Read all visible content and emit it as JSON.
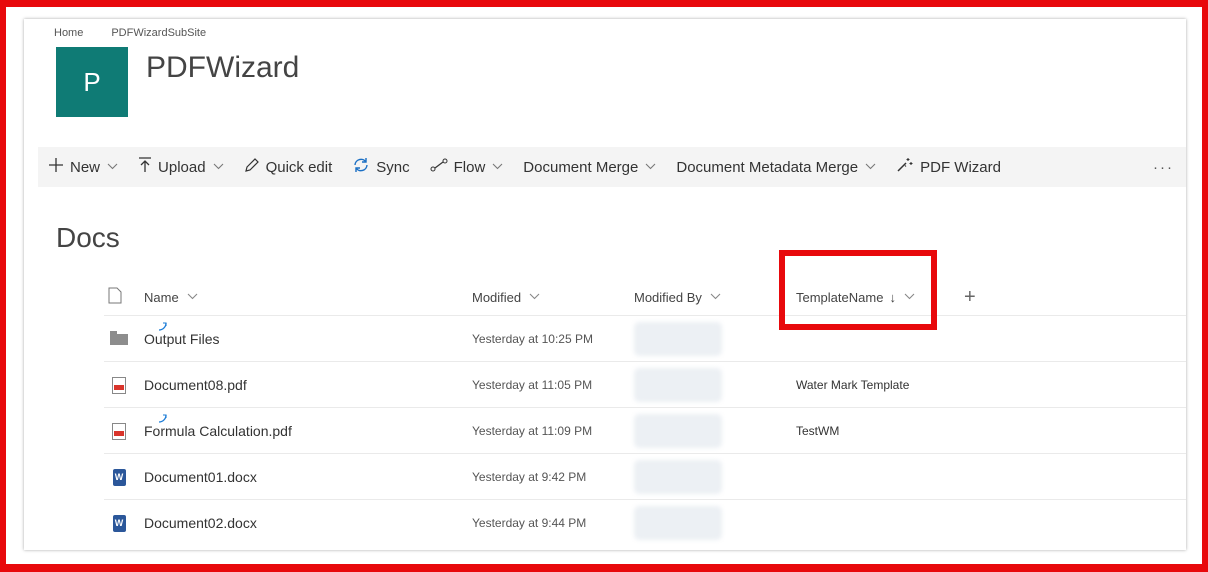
{
  "breadcrumb": [
    "Home",
    "PDFWizardSubSite"
  ],
  "site": {
    "logo_letter": "P",
    "title": "PDFWizard"
  },
  "commands": [
    {
      "id": "new",
      "icon": "plus-icon",
      "label": "New",
      "dropdown": true
    },
    {
      "id": "upload",
      "icon": "upload-icon",
      "label": "Upload",
      "dropdown": true
    },
    {
      "id": "quick-edit",
      "icon": "pencil-icon",
      "label": "Quick edit",
      "dropdown": false
    },
    {
      "id": "sync",
      "icon": "sync-icon",
      "label": "Sync",
      "dropdown": false
    },
    {
      "id": "flow",
      "icon": "flow-icon",
      "label": "Flow",
      "dropdown": true
    },
    {
      "id": "document-merge",
      "icon": "",
      "label": "Document Merge",
      "dropdown": true
    },
    {
      "id": "document-metadata-merge",
      "icon": "",
      "label": "Document Metadata Merge",
      "dropdown": true
    },
    {
      "id": "pdf-wizard",
      "icon": "wand-icon",
      "label": "PDF Wizard",
      "dropdown": false
    }
  ],
  "more_label": "···",
  "list_title": "Docs",
  "columns": {
    "name": "Name",
    "modified": "Modified",
    "modified_by": "Modified By",
    "template_name": "TemplateName",
    "sort_indicator": "↓",
    "add_column": "+"
  },
  "rows": [
    {
      "type": "folder",
      "name": "Output Files",
      "modified": "Yesterday at 10:25 PM",
      "template": "",
      "new": true
    },
    {
      "type": "pdf",
      "name": "Document08.pdf",
      "modified": "Yesterday at 11:05 PM",
      "template": "Water Mark Template",
      "new": false
    },
    {
      "type": "pdf",
      "name": "Formula Calculation.pdf",
      "modified": "Yesterday at 11:09 PM",
      "template": "TestWM",
      "new": true
    },
    {
      "type": "docx",
      "name": "Document01.docx",
      "modified": "Yesterday at 9:42 PM",
      "template": "",
      "new": false
    },
    {
      "type": "docx",
      "name": "Document02.docx",
      "modified": "Yesterday at 9:44 PM",
      "template": "",
      "new": false
    }
  ],
  "colors": {
    "highlight": "#e8090c",
    "logo": "#0f7b75",
    "commandbar": "#f4f4f4"
  }
}
